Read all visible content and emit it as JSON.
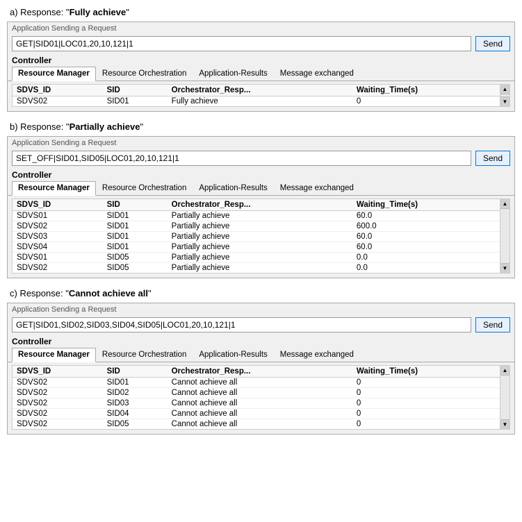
{
  "sections": [
    {
      "id": "section-a",
      "label": "a)   Response: \"",
      "label_bold": "Fully achieve",
      "label_end": "\"",
      "app_request_label": "Application Sending a Request",
      "request_value": "GET|SID01|LOC01,20,10,121|1",
      "send_label": "Send",
      "controller_label": "Controller",
      "tabs": [
        "Resource Manager",
        "Resource Orchestration",
        "Application-Results",
        "Message exchanged"
      ],
      "active_tab": "Resource Manager",
      "columns": [
        "SDVS_ID",
        "SID",
        "Orchestrator_Resp...",
        "Waiting_Time(s)"
      ],
      "rows": [
        [
          "SDVS02",
          "SID01",
          "Fully achieve",
          "0"
        ]
      ]
    },
    {
      "id": "section-b",
      "label": "b)   Response: \"",
      "label_bold": "Partially achieve",
      "label_end": "\"",
      "app_request_label": "Application Sending a Request",
      "request_value": "SET_OFF|SID01,SID05|LOC01,20,10,121|1",
      "send_label": "Send",
      "controller_label": "Controller",
      "tabs": [
        "Resource Manager",
        "Resource Orchestration",
        "Application-Results",
        "Message exchanged"
      ],
      "active_tab": "Resource Manager",
      "columns": [
        "SDVS_ID",
        "SID",
        "Orchestrator_Resp...",
        "Waiting_Time(s)"
      ],
      "rows": [
        [
          "SDVS01",
          "SID01",
          "Partially achieve",
          "60.0"
        ],
        [
          "SDVS02",
          "SID01",
          "Partially achieve",
          "600.0"
        ],
        [
          "SDVS03",
          "SID01",
          "Partially achieve",
          "60.0"
        ],
        [
          "SDVS04",
          "SID01",
          "Partially achieve",
          "60.0"
        ],
        [
          "SDVS01",
          "SID05",
          "Partially achieve",
          "0.0"
        ],
        [
          "SDVS02",
          "SID05",
          "Partially achieve",
          "0.0"
        ]
      ]
    },
    {
      "id": "section-c",
      "label": "c)   Response: \"",
      "label_bold": "Cannot achieve all",
      "label_end": "\"",
      "app_request_label": "Application Sending a Request",
      "request_value": "GET|SID01,SID02,SID03,SID04,SID05|LOC01,20,10,121|1",
      "send_label": "Send",
      "controller_label": "Controller",
      "tabs": [
        "Resource Manager",
        "Resource Orchestration",
        "Application-Results",
        "Message exchanged"
      ],
      "active_tab": "Resource Manager",
      "columns": [
        "SDVS_ID",
        "SID",
        "Orchestrator_Resp...",
        "Waiting_Time(s)"
      ],
      "rows": [
        [
          "SDVS02",
          "SID01",
          "Cannot achieve all",
          "0"
        ],
        [
          "SDVS02",
          "SID02",
          "Cannot achieve all",
          "0"
        ],
        [
          "SDVS02",
          "SID03",
          "Cannot achieve all",
          "0"
        ],
        [
          "SDVS02",
          "SID04",
          "Cannot achieve all",
          "0"
        ],
        [
          "SDVS02",
          "SID05",
          "Cannot achieve all",
          "0"
        ]
      ]
    }
  ]
}
